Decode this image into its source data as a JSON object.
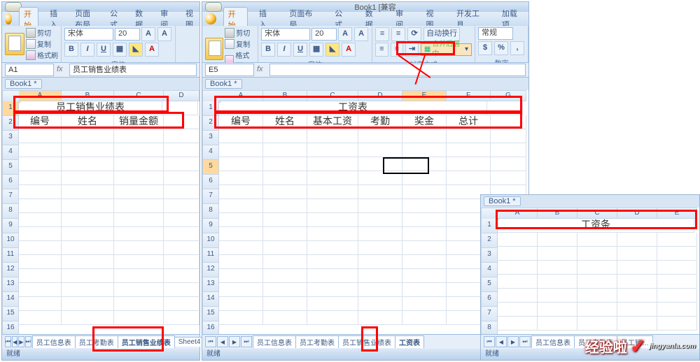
{
  "workbook_name": "Book1",
  "titlebar_suffix": "[兼容",
  "status": "就绪",
  "menus_small": [
    "开始",
    "插入",
    "页面布局",
    "公式",
    "数据",
    "审阅",
    "视图"
  ],
  "menus_large": [
    "开始",
    "插入",
    "页面布局",
    "公式",
    "数据",
    "审阅",
    "视图",
    "开发工具",
    "加载项"
  ],
  "clipboard": {
    "cut": "剪切",
    "copy": "复制",
    "brush": "格式刷",
    "paste": "粘贴",
    "group": "剪贴板"
  },
  "font": {
    "name": "宋体",
    "size": "20",
    "group": "字体"
  },
  "align": {
    "wrap": "自动换行",
    "merge": "合并后居中",
    "group": "对齐方式"
  },
  "number": {
    "general": "常规",
    "group": "数字"
  },
  "book_tab": "Book1 *",
  "left": {
    "namebox": "A1",
    "formula": "员工销售业绩表",
    "title": "员工销售业绩表",
    "headers": [
      "编号",
      "姓名",
      "销量金额"
    ],
    "cols": [
      "A",
      "B",
      "C",
      "D"
    ],
    "tabs": [
      "员工信息表",
      "员工考勤表",
      "员工销售业绩表",
      "Sheet4"
    ],
    "active_tab": "员工销售业绩表"
  },
  "mid": {
    "namebox": "E5",
    "formula": "",
    "title": "工资表",
    "headers": [
      "编号",
      "姓名",
      "基本工资",
      "考勤",
      "奖金",
      "总计"
    ],
    "cols": [
      "A",
      "B",
      "C",
      "D",
      "E",
      "F",
      "G"
    ],
    "tabs": [
      "员工信息表",
      "员工考勤表",
      "员工销售业绩表",
      "工资表"
    ],
    "active_tab": "工资表"
  },
  "right": {
    "title": "工资条",
    "cols": [
      "A",
      "B",
      "C",
      "D",
      "E"
    ],
    "tabs": [
      "员工信息表",
      "员工考勤表",
      "员工销…"
    ]
  }
}
